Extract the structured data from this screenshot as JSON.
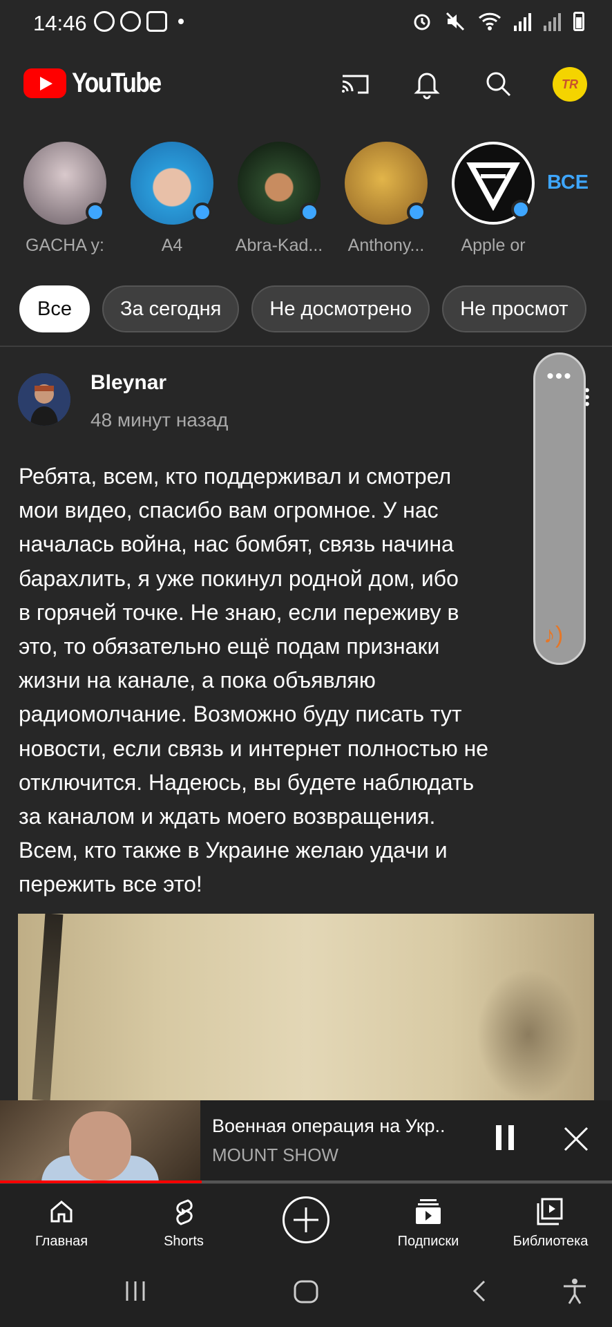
{
  "status_bar": {
    "time": "14:46"
  },
  "header": {
    "app_name": "YouTube"
  },
  "channels": [
    {
      "name": "GACHA у:",
      "color": "#9a8f96"
    },
    {
      "name": "A4",
      "color": "#2f8fd1"
    },
    {
      "name": "Abra-Kad...",
      "color": "#1a2a1a"
    },
    {
      "name": "Anthony...",
      "color": "#b08a34"
    },
    {
      "name": "Apple or",
      "color": "#101010"
    }
  ],
  "channels_all_label": "ВСЕ",
  "filters": [
    "Все",
    "За сегодня",
    "Не досмотрено",
    "Не просмот"
  ],
  "post": {
    "author": "Bleynar",
    "time": "48 минут назад",
    "lines": [
      "Ребята, всем, кто поддерживал и смотрел",
      "мои видео, спасибо вам огромное. У нас",
      "началась война, нас бомбят, связь начина",
      "барахлить, я уже покинул родной дом, ибо",
      "в горячей точке. Не знаю, если переживу в",
      "это, то обязательно ещё подам признаки",
      "жизни на канале, а пока объявляю",
      "радиомолчание. Возможно буду писать тут",
      "новости, если связь и интернет полностью не",
      "отключится. Надеюсь, вы будете наблюдать",
      "за каналом и ждать моего возвращения.",
      "Всем, кто также в Украине желаю удачи и",
      "пережить все это!"
    ]
  },
  "mini_player": {
    "title": "Военная операция на Укр..",
    "channel": "MOUNT SHOW",
    "progress": 0.33
  },
  "nav": {
    "home": "Главная",
    "shorts": "Shorts",
    "subscriptions": "Подписки",
    "library": "Библиотека"
  }
}
